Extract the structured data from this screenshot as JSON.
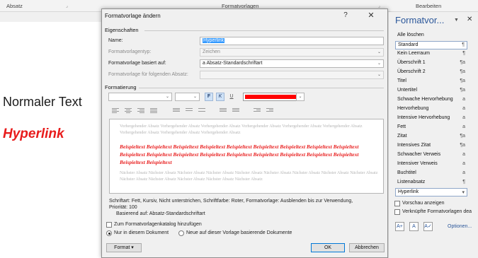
{
  "ribbon": {
    "group_paragraph": "Absatz",
    "group_styles": "Formatvorlagen",
    "group_edit": "Bearbeiten"
  },
  "document": {
    "normal_text": "Normaler Text",
    "hyperlink_text": "Hyperlink"
  },
  "dialog": {
    "title": "Formatvorlage ändern",
    "help": "?",
    "close": "✕",
    "properties_header": "Eigenschaften",
    "name_label": "Name:",
    "name_value": "Hyperlink",
    "type_label": "Formatvorlagentyp:",
    "type_value": "Zeichen",
    "based_label": "Formatvorlage basiert auf:",
    "based_value": "a Absatz-Standardschriftart",
    "next_label": "Formatvorlage für folgenden Absatz:",
    "formatting_header": "Formatierung",
    "bold": "F",
    "italic": "K",
    "underline": "U",
    "font_color": "#ff0000",
    "preview_prev": "Vorhergehender Absatz Vorhergehender Absatz Vorhergehender Absatz Vorhergehender Absatz Vorhergehender Absatz Vorhergehender Absatz Vorhergehender Absatz Vorhergehender Absatz Vorhergehender Absatz",
    "preview_sample": "Beispieltext Beispieltext Beispieltext Beispieltext Beispieltext Beispieltext Beispieltext Beispieltext Beispieltext Beispieltext Beispieltext Beispieltext Beispieltext Beispieltext Beispieltext Beispieltext Beispieltext Beispieltext Beispieltext Beispieltext",
    "preview_next": "Nächster Absatz Nächster Absatz Nächster Absatz Nächster Absatz Nächster Absatz Nächster Absatz Nächster Absatz Nächster Absatz Nächster Absatz Nächster Absatz Nächster Absatz Nächster Absatz Nächster Absatz Nächster Absatz",
    "desc_line1": "Schriftart: Fett, Kursiv, Nicht unterstrichen, Schriftfarbe: Roter, Formatvorlage: Ausblenden bis zur Verwendung,",
    "desc_line2": "Priorität: 100",
    "desc_line3": "Basierend auf: Absatz-Standardschriftart",
    "add_gallery": "Zum Formatvorlagenkatalog hinzufügen",
    "only_doc": "Nur in diesem Dokument",
    "new_docs": "Neue auf dieser Vorlage basierende Dokumente",
    "format_btn": "Format ▾",
    "ok_btn": "OK",
    "cancel_btn": "Abbrechen"
  },
  "pane": {
    "title": "Formatvor...",
    "caret": "▼",
    "close": "✕",
    "styles": [
      {
        "name": "Alle löschen",
        "mark": ""
      },
      {
        "name": "Standard",
        "mark": "¶"
      },
      {
        "name": "Kein Leerraum",
        "mark": "¶"
      },
      {
        "name": "Überschrift 1",
        "mark": "¶a"
      },
      {
        "name": "Überschrift 2",
        "mark": "¶a"
      },
      {
        "name": "Titel",
        "mark": "¶a"
      },
      {
        "name": "Untertitel",
        "mark": "¶a"
      },
      {
        "name": "Schwache Hervorhebung",
        "mark": "a"
      },
      {
        "name": "Hervorhebung",
        "mark": "a"
      },
      {
        "name": "Intensive Hervorhebung",
        "mark": "a"
      },
      {
        "name": "Fett",
        "mark": "a"
      },
      {
        "name": "Zitat",
        "mark": "¶a"
      },
      {
        "name": "Intensives Zitat",
        "mark": "¶a"
      },
      {
        "name": "Schwacher Verweis",
        "mark": "a"
      },
      {
        "name": "Intensiver Verweis",
        "mark": "a"
      },
      {
        "name": "Buchtitel",
        "mark": "a"
      },
      {
        "name": "Listenabsatz",
        "mark": "¶"
      },
      {
        "name": "Hyperlink",
        "mark": "▾"
      }
    ],
    "show_preview": "Vorschau anzeigen",
    "linked_styles": "Verknüpfte Formatvorlagen dea",
    "options_link": "Optionen...",
    "icon_new": "A+",
    "icon_inspect": "A",
    "icon_manage": "A✓"
  }
}
